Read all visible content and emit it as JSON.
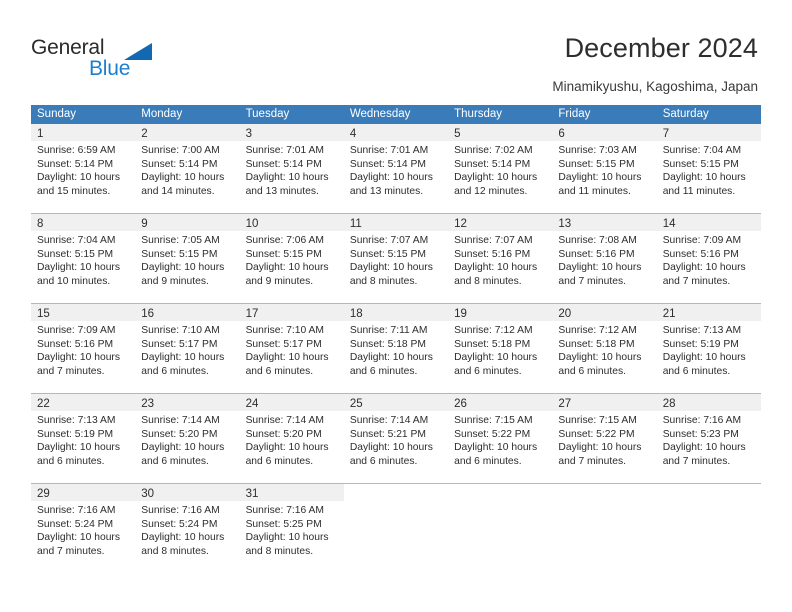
{
  "brand": {
    "name_part1": "General",
    "name_part2": "Blue",
    "triangle_color": "#1368b2",
    "blue_color": "#1c7fd0"
  },
  "header": {
    "title": "December 2024",
    "subtitle": "Minamikyushu, Kagoshima, Japan"
  },
  "calendar": {
    "header_bg": "#3a7cba",
    "numband_bg": "#f0f0f0",
    "row_divider": "#9fbcd8",
    "weekday_headers": [
      "Sunday",
      "Monday",
      "Tuesday",
      "Wednesday",
      "Thursday",
      "Friday",
      "Saturday"
    ],
    "weeks": [
      [
        {
          "day": "1",
          "sunrise": "Sunrise: 6:59 AM",
          "sunset": "Sunset: 5:14 PM",
          "daylight1": "Daylight: 10 hours",
          "daylight2": "and 15 minutes."
        },
        {
          "day": "2",
          "sunrise": "Sunrise: 7:00 AM",
          "sunset": "Sunset: 5:14 PM",
          "daylight1": "Daylight: 10 hours",
          "daylight2": "and 14 minutes."
        },
        {
          "day": "3",
          "sunrise": "Sunrise: 7:01 AM",
          "sunset": "Sunset: 5:14 PM",
          "daylight1": "Daylight: 10 hours",
          "daylight2": "and 13 minutes."
        },
        {
          "day": "4",
          "sunrise": "Sunrise: 7:01 AM",
          "sunset": "Sunset: 5:14 PM",
          "daylight1": "Daylight: 10 hours",
          "daylight2": "and 13 minutes."
        },
        {
          "day": "5",
          "sunrise": "Sunrise: 7:02 AM",
          "sunset": "Sunset: 5:14 PM",
          "daylight1": "Daylight: 10 hours",
          "daylight2": "and 12 minutes."
        },
        {
          "day": "6",
          "sunrise": "Sunrise: 7:03 AM",
          "sunset": "Sunset: 5:15 PM",
          "daylight1": "Daylight: 10 hours",
          "daylight2": "and 11 minutes."
        },
        {
          "day": "7",
          "sunrise": "Sunrise: 7:04 AM",
          "sunset": "Sunset: 5:15 PM",
          "daylight1": "Daylight: 10 hours",
          "daylight2": "and 11 minutes."
        }
      ],
      [
        {
          "day": "8",
          "sunrise": "Sunrise: 7:04 AM",
          "sunset": "Sunset: 5:15 PM",
          "daylight1": "Daylight: 10 hours",
          "daylight2": "and 10 minutes."
        },
        {
          "day": "9",
          "sunrise": "Sunrise: 7:05 AM",
          "sunset": "Sunset: 5:15 PM",
          "daylight1": "Daylight: 10 hours",
          "daylight2": "and 9 minutes."
        },
        {
          "day": "10",
          "sunrise": "Sunrise: 7:06 AM",
          "sunset": "Sunset: 5:15 PM",
          "daylight1": "Daylight: 10 hours",
          "daylight2": "and 9 minutes."
        },
        {
          "day": "11",
          "sunrise": "Sunrise: 7:07 AM",
          "sunset": "Sunset: 5:15 PM",
          "daylight1": "Daylight: 10 hours",
          "daylight2": "and 8 minutes."
        },
        {
          "day": "12",
          "sunrise": "Sunrise: 7:07 AM",
          "sunset": "Sunset: 5:16 PM",
          "daylight1": "Daylight: 10 hours",
          "daylight2": "and 8 minutes."
        },
        {
          "day": "13",
          "sunrise": "Sunrise: 7:08 AM",
          "sunset": "Sunset: 5:16 PM",
          "daylight1": "Daylight: 10 hours",
          "daylight2": "and 7 minutes."
        },
        {
          "day": "14",
          "sunrise": "Sunrise: 7:09 AM",
          "sunset": "Sunset: 5:16 PM",
          "daylight1": "Daylight: 10 hours",
          "daylight2": "and 7 minutes."
        }
      ],
      [
        {
          "day": "15",
          "sunrise": "Sunrise: 7:09 AM",
          "sunset": "Sunset: 5:16 PM",
          "daylight1": "Daylight: 10 hours",
          "daylight2": "and 7 minutes."
        },
        {
          "day": "16",
          "sunrise": "Sunrise: 7:10 AM",
          "sunset": "Sunset: 5:17 PM",
          "daylight1": "Daylight: 10 hours",
          "daylight2": "and 6 minutes."
        },
        {
          "day": "17",
          "sunrise": "Sunrise: 7:10 AM",
          "sunset": "Sunset: 5:17 PM",
          "daylight1": "Daylight: 10 hours",
          "daylight2": "and 6 minutes."
        },
        {
          "day": "18",
          "sunrise": "Sunrise: 7:11 AM",
          "sunset": "Sunset: 5:18 PM",
          "daylight1": "Daylight: 10 hours",
          "daylight2": "and 6 minutes."
        },
        {
          "day": "19",
          "sunrise": "Sunrise: 7:12 AM",
          "sunset": "Sunset: 5:18 PM",
          "daylight1": "Daylight: 10 hours",
          "daylight2": "and 6 minutes."
        },
        {
          "day": "20",
          "sunrise": "Sunrise: 7:12 AM",
          "sunset": "Sunset: 5:18 PM",
          "daylight1": "Daylight: 10 hours",
          "daylight2": "and 6 minutes."
        },
        {
          "day": "21",
          "sunrise": "Sunrise: 7:13 AM",
          "sunset": "Sunset: 5:19 PM",
          "daylight1": "Daylight: 10 hours",
          "daylight2": "and 6 minutes."
        }
      ],
      [
        {
          "day": "22",
          "sunrise": "Sunrise: 7:13 AM",
          "sunset": "Sunset: 5:19 PM",
          "daylight1": "Daylight: 10 hours",
          "daylight2": "and 6 minutes."
        },
        {
          "day": "23",
          "sunrise": "Sunrise: 7:14 AM",
          "sunset": "Sunset: 5:20 PM",
          "daylight1": "Daylight: 10 hours",
          "daylight2": "and 6 minutes."
        },
        {
          "day": "24",
          "sunrise": "Sunrise: 7:14 AM",
          "sunset": "Sunset: 5:20 PM",
          "daylight1": "Daylight: 10 hours",
          "daylight2": "and 6 minutes."
        },
        {
          "day": "25",
          "sunrise": "Sunrise: 7:14 AM",
          "sunset": "Sunset: 5:21 PM",
          "daylight1": "Daylight: 10 hours",
          "daylight2": "and 6 minutes."
        },
        {
          "day": "26",
          "sunrise": "Sunrise: 7:15 AM",
          "sunset": "Sunset: 5:22 PM",
          "daylight1": "Daylight: 10 hours",
          "daylight2": "and 6 minutes."
        },
        {
          "day": "27",
          "sunrise": "Sunrise: 7:15 AM",
          "sunset": "Sunset: 5:22 PM",
          "daylight1": "Daylight: 10 hours",
          "daylight2": "and 7 minutes."
        },
        {
          "day": "28",
          "sunrise": "Sunrise: 7:16 AM",
          "sunset": "Sunset: 5:23 PM",
          "daylight1": "Daylight: 10 hours",
          "daylight2": "and 7 minutes."
        }
      ],
      [
        {
          "day": "29",
          "sunrise": "Sunrise: 7:16 AM",
          "sunset": "Sunset: 5:24 PM",
          "daylight1": "Daylight: 10 hours",
          "daylight2": "and 7 minutes."
        },
        {
          "day": "30",
          "sunrise": "Sunrise: 7:16 AM",
          "sunset": "Sunset: 5:24 PM",
          "daylight1": "Daylight: 10 hours",
          "daylight2": "and 8 minutes."
        },
        {
          "day": "31",
          "sunrise": "Sunrise: 7:16 AM",
          "sunset": "Sunset: 5:25 PM",
          "daylight1": "Daylight: 10 hours",
          "daylight2": "and 8 minutes."
        },
        {
          "day": "",
          "sunrise": "",
          "sunset": "",
          "daylight1": "",
          "daylight2": ""
        },
        {
          "day": "",
          "sunrise": "",
          "sunset": "",
          "daylight1": "",
          "daylight2": ""
        },
        {
          "day": "",
          "sunrise": "",
          "sunset": "",
          "daylight1": "",
          "daylight2": ""
        },
        {
          "day": "",
          "sunrise": "",
          "sunset": "",
          "daylight1": "",
          "daylight2": ""
        }
      ]
    ]
  }
}
